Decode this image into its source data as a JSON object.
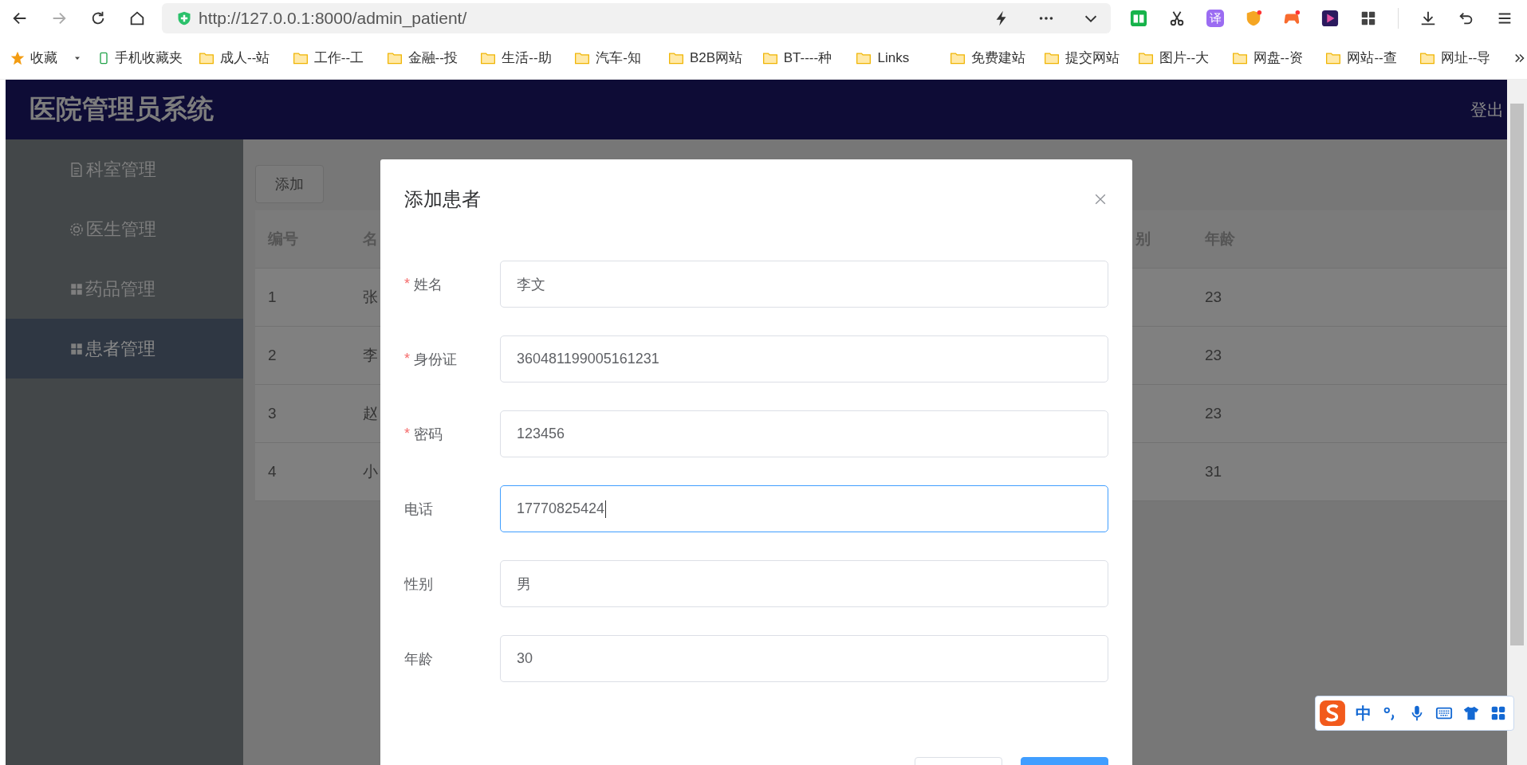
{
  "browser": {
    "url": "http://127.0.0.1:8000/admin_patient/",
    "translate_label": "译"
  },
  "bookmarks": [
    {
      "kind": "star",
      "label": "收藏"
    },
    {
      "kind": "mobile",
      "label": "手机收藏夹"
    },
    {
      "kind": "folder",
      "label": "成人--站"
    },
    {
      "kind": "folder",
      "label": "工作--工"
    },
    {
      "kind": "folder",
      "label": "金融--投"
    },
    {
      "kind": "folder",
      "label": "生活--助"
    },
    {
      "kind": "folder",
      "label": "汽车-知"
    },
    {
      "kind": "folder",
      "label": "B2B网站"
    },
    {
      "kind": "folder",
      "label": "BT----种"
    },
    {
      "kind": "folder",
      "label": "Links"
    },
    {
      "kind": "folder",
      "label": "免费建站"
    },
    {
      "kind": "folder",
      "label": "提交网站"
    },
    {
      "kind": "folder",
      "label": "图片--大"
    },
    {
      "kind": "folder",
      "label": "网盘--资"
    },
    {
      "kind": "folder",
      "label": "网站--查"
    },
    {
      "kind": "folder",
      "label": "网址--导"
    }
  ],
  "app": {
    "title": "医院管理员系统",
    "logout": "登出"
  },
  "sidebar": {
    "items": [
      {
        "label": "科室管理",
        "selected": false
      },
      {
        "label": "医生管理",
        "selected": false
      },
      {
        "label": "药品管理",
        "selected": false
      },
      {
        "label": "患者管理",
        "selected": true
      }
    ]
  },
  "add_button": "添加",
  "table": {
    "columns": [
      {
        "label": "编号"
      },
      {
        "label": "名"
      },
      {
        "label": "别"
      },
      {
        "label": "年龄"
      }
    ],
    "rows": [
      {
        "number": "1",
        "column_2": "张",
        "age": "23"
      },
      {
        "number": "2",
        "column_2": "李",
        "age": "23"
      },
      {
        "number": "3",
        "column_2": "赵",
        "age": "23"
      },
      {
        "number": "4",
        "column_2": "小",
        "age": "31"
      }
    ]
  },
  "dialog": {
    "title": "添加患者",
    "fields": [
      {
        "required_mark": "*",
        "label": "姓名",
        "value": "李文",
        "focused": false
      },
      {
        "required_mark": "*",
        "label": "身份证",
        "value": "360481199005161231",
        "focused": false
      },
      {
        "required_mark": "*",
        "label": "密码",
        "value": "123456",
        "focused": false
      },
      {
        "label": "电话",
        "value": "17770825424",
        "focused": true
      },
      {
        "label": "性别",
        "value": "男",
        "focused": false
      },
      {
        "label": "年龄",
        "value": "30",
        "focused": false
      }
    ]
  },
  "ime": {
    "mode": "中"
  }
}
